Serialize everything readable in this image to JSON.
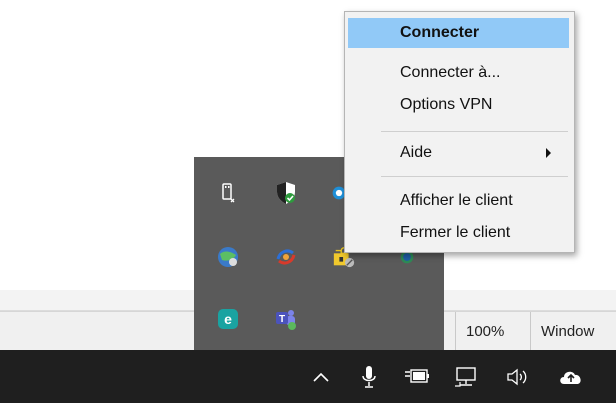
{
  "context_menu": {
    "items": [
      {
        "label": "Connecter",
        "highlighted": true
      },
      {
        "label": "Connecter à..."
      },
      {
        "label": "Options VPN"
      },
      {
        "label": "Aide",
        "has_submenu": true
      },
      {
        "label": "Afficher le client"
      },
      {
        "label": "Fermer le client"
      }
    ]
  },
  "status_bar": {
    "zoom": "100%",
    "os": "Window"
  },
  "tray_overflow": {
    "icons": [
      "usb-eject-icon",
      "shield-check-icon",
      "blue-app-icon",
      "network-globe-icon",
      "sync-arrows-icon",
      "lock-folder-icon",
      "vpn-globe-icon",
      "eset-icon",
      "teams-icon"
    ]
  },
  "taskbar": {
    "icons": [
      "chevron-up-icon",
      "microphone-icon",
      "battery-plug-icon",
      "network-icon",
      "speaker-icon",
      "cloud-upload-icon"
    ]
  },
  "colors": {
    "menu_highlight": "#91c9f7",
    "taskbar": "#1f1f1f",
    "flyout": "#5a5a5a"
  }
}
